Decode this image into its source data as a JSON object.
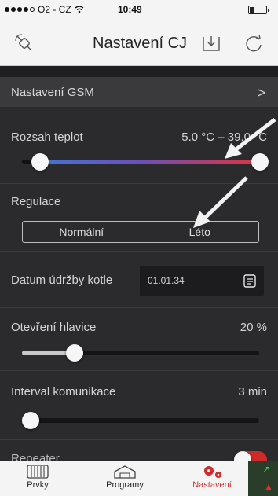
{
  "status": {
    "carrier": "O2 - CZ",
    "time": "10:49"
  },
  "nav": {
    "title": "Nastavení CJ",
    "left_icon": "satellite-icon",
    "download_icon": "download-icon",
    "refresh_icon": "refresh-icon"
  },
  "gsm": {
    "label": "Nastavení GSM",
    "chevron": ">"
  },
  "temp_range": {
    "label": "Rozsah teplot",
    "value": "5.0 °C – 39.0 °C",
    "min_fraction": 0.0,
    "max_fraction": 1.0
  },
  "regulation": {
    "label": "Regulace",
    "options": [
      "Normální",
      "Léto"
    ]
  },
  "boiler": {
    "label": "Datum údržby kotle",
    "date": "01.01.34",
    "icon": "calendar-icon"
  },
  "valve": {
    "label": "Otevření hlavice",
    "value": "20 %",
    "fraction": 0.2
  },
  "comm": {
    "label": "Interval komunikace",
    "value": "3 min",
    "fraction": 0.0
  },
  "repeater": {
    "label": "Repeater"
  },
  "tabs": [
    {
      "label": "Prvky",
      "icon": "radiator-icon"
    },
    {
      "label": "Programy",
      "icon": "house-icon"
    },
    {
      "label": "Nastavení",
      "icon": "gears-icon"
    }
  ],
  "colors": {
    "accent": "#d02a2a",
    "range_start": "#3c7ad8",
    "range_end": "#e0333f",
    "annotation_arrow": "#f2f2f2"
  }
}
